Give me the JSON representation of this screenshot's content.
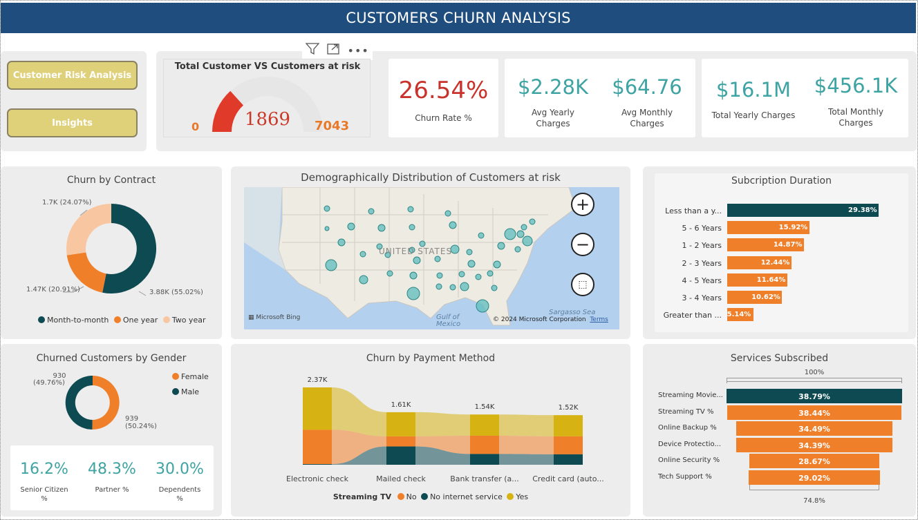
{
  "header": {
    "title": "CUSTOMERS CHURN ANALYSIS"
  },
  "nav": {
    "risk_button": "Customer Risk Analysis",
    "insights_button": "Insights"
  },
  "toolbar": {
    "filter_icon": "filter-icon",
    "focus_icon": "focus-mode-icon",
    "more_icon": "more-options-icon"
  },
  "gauge": {
    "title": "Total Customer VS Customers at risk",
    "min_label": "0",
    "value_label": "1869",
    "max_label": "7043",
    "value": 1869,
    "max": 7043,
    "fill_color": "#e03a2b"
  },
  "kpis": {
    "churn_rate": {
      "value": "26.54%",
      "label": "Churn Rate %"
    },
    "avg_yearly": {
      "value": "$2.28K",
      "label_line1": "Avg Yearly",
      "label_line2": "Charges"
    },
    "avg_monthly": {
      "value": "$64.76",
      "label_line1": "Avg Monthly",
      "label_line2": "Charges"
    },
    "total_yearly": {
      "value": "$16.1M",
      "label": "Total Yearly Charges"
    },
    "total_monthly": {
      "value": "$456.1K",
      "label_line1": "Total Monthly",
      "label_line2": "Charges"
    }
  },
  "contract": {
    "title": "Churn by Contract",
    "labels": {
      "two_year": "1.7K (24.07%)",
      "one_year": "1.47K (20.91%)",
      "month": "3.88K (55.02%)"
    },
    "legend": [
      "Month-to-month",
      "One year",
      "Two year"
    ]
  },
  "map": {
    "title": "Demographically Distribution of Customers at risk",
    "country_label": "UNITED STATES",
    "gulf_label": "Gulf of\nMexico",
    "sea_label": "Sargasso Sea",
    "bing_label": "Microsoft Bing",
    "copyright": "© 2024 Microsoft Corporation",
    "terms": "Terms"
  },
  "duration": {
    "title": "Subcription Duration",
    "bars": [
      {
        "label": "Less than a y...",
        "value": 29.38,
        "text": "29.38%"
      },
      {
        "label": "5 - 6 Years",
        "value": 15.92,
        "text": "15.92%"
      },
      {
        "label": "1 - 2 Years",
        "value": 14.87,
        "text": "14.87%"
      },
      {
        "label": "2 - 3 Years",
        "value": 12.44,
        "text": "12.44%"
      },
      {
        "label": "4 - 5 Years",
        "value": 11.64,
        "text": "11.64%"
      },
      {
        "label": "3 - 4 Years",
        "value": 10.62,
        "text": "10.62%"
      },
      {
        "label": "Greater than ...",
        "value": 5.14,
        "text": "5.14%"
      }
    ]
  },
  "gender": {
    "title": "Churned Customers by Gender",
    "female_label_line1": "939",
    "female_label_line2": "(50.24%)",
    "male_label_line1": "930",
    "male_label_line2": "(49.76%)",
    "legend": [
      "Female",
      "Male"
    ]
  },
  "demo_kpis": {
    "senior": {
      "value": "16.2%",
      "label_line1": "Senior Citizen",
      "label_line2": "%"
    },
    "partner": {
      "value": "48.3%",
      "label": "Partner %"
    },
    "dependents": {
      "value": "30.0%",
      "label_line1": "Dependents",
      "label_line2": "%"
    }
  },
  "payment": {
    "title": "Churn by Payment Method",
    "legend_title": "Streaming TV",
    "legend": [
      "No",
      "No internet service",
      "Yes"
    ],
    "colors": {
      "no": "#f07f2a",
      "no_internet": "#0e4a52",
      "yes": "#d6b312"
    }
  },
  "chart_data": {
    "type": "bar",
    "title": "Churn by Payment Method",
    "categories": [
      "Electronic check",
      "Mailed check",
      "Bank transfer (a...",
      "Credit card (auto..."
    ],
    "totals": [
      2.37,
      1.61,
      1.54,
      1.52
    ],
    "total_labels": [
      "2.37K",
      "1.61K",
      "1.54K",
      "1.52K"
    ],
    "series": [
      {
        "name": "No",
        "values": [
          1.05,
          0.31,
          0.56,
          0.55
        ]
      },
      {
        "name": "No internet service",
        "values": [
          0.02,
          0.56,
          0.33,
          0.32
        ]
      },
      {
        "name": "Yes",
        "values": [
          1.3,
          0.74,
          0.65,
          0.65
        ]
      }
    ],
    "unit": "K"
  },
  "services": {
    "title": "Services Subscribed",
    "top_label": "100%",
    "bottom_label": "74.8%",
    "bars": [
      {
        "label": "Streaming Movie...",
        "value": 38.79,
        "text": "38.79%"
      },
      {
        "label": "Streaming TV %",
        "value": 38.44,
        "text": "38.44%"
      },
      {
        "label": "Online Backup %",
        "value": 34.49,
        "text": "34.49%"
      },
      {
        "label": "Device Protectio...",
        "value": 34.39,
        "text": "34.39%"
      },
      {
        "label": "Online Security %",
        "value": 28.67,
        "text": "28.67%"
      },
      {
        "label": "Tech Support %",
        "value": 29.02,
        "text": "29.02%"
      }
    ]
  }
}
